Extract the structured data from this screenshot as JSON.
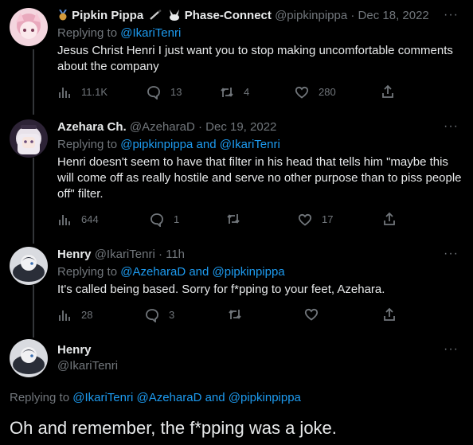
{
  "tweets": [
    {
      "name": "Pipkin Pippa",
      "name_extra": "Phase-Connect",
      "handle": "@pipkinpippa",
      "date": "· Dec 18, 2022",
      "replying_prefix": "Replying to",
      "replying_links": [
        "@IkariTenri"
      ],
      "text": "Jesus Christ Henri I just want you to stop making uncomfortable comments about the company",
      "views": "11.1K",
      "replies": "13",
      "retweets": "4",
      "likes": "280"
    },
    {
      "name": "Azehara Ch.",
      "handle": "@AzeharaD",
      "date": "· Dec 19, 2022",
      "replying_prefix": "Replying to",
      "replying_links": [
        "@pipkinpippa",
        "@IkariTenri"
      ],
      "joiner": "and",
      "text": "Henri doesn't seem to have that filter in his head that tells him \"maybe this will come off as really hostile and serve no other purpose than to piss people off\" filter.",
      "views": "644",
      "replies": "1",
      "retweets": "",
      "likes": "17"
    },
    {
      "name": "Henry",
      "handle": "@IkariTenri",
      "date": "· 11h",
      "replying_prefix": "Replying to",
      "replying_links": [
        "@AzeharaD",
        "@pipkinpippa"
      ],
      "joiner": "and",
      "text": "It's called being based. Sorry for f*pping to your feet, Azehara.",
      "views": "28",
      "replies": "3",
      "retweets": "",
      "likes": ""
    }
  ],
  "main": {
    "name": "Henry",
    "handle": "@IkariTenri",
    "replying_prefix": "Replying to",
    "replying_links": [
      "@IkariTenri",
      "@AzeharaD"
    ],
    "joiner": "and",
    "last_link": "@pipkinpippa",
    "text": "Oh and remember, the f*pping was a joke."
  },
  "more_glyph": "···",
  "colors": {
    "accent": "#1d9bf0",
    "muted": "#71767b",
    "text": "#e7e9ea",
    "bg": "#000000"
  }
}
